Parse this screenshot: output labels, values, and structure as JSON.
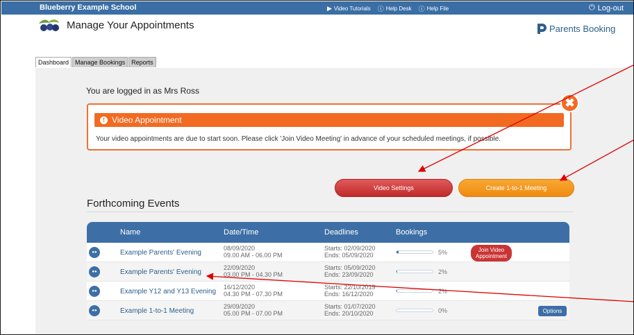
{
  "topbar": {
    "school": "Blueberry Example School",
    "links": [
      "Video Tutorials",
      "Help Desk",
      "Help File"
    ],
    "logout": "Log-out"
  },
  "header": {
    "title": "Manage Your Appointments",
    "brand": "Parents Booking"
  },
  "tabs": [
    "Dashboard",
    "Manage Bookings",
    "Reports"
  ],
  "active_tab": "Dashboard",
  "main": {
    "logged_in": "You are logged in as Mrs Ross",
    "alert": {
      "title": "Video Appointment",
      "body": "Your video appointments are due to start soon. Please click 'Join Video Meeting' in advance of your scheduled meetings, if possible."
    },
    "video_settings": "Video Settings",
    "create_meeting": "Create 1-to-1 Meeting",
    "section_title": "Forthcoming Events",
    "columns": [
      "Name",
      "Date/Time",
      "Deadlines",
      "Bookings"
    ],
    "events": [
      {
        "name": "Example Parents' Evening",
        "date": "08/09/2020",
        "time": "09.00 AM - 06.00 PM",
        "starts": "Starts: 02/09/2020",
        "ends": "Ends: 05/09/2020",
        "bookings_pct": "5%",
        "progress": 0.05,
        "action": "Join Video Appointment"
      },
      {
        "name": "Example Parents' Evening",
        "date": "22/09/2020",
        "time": "03.00 PM - 04.30 PM",
        "starts": "Starts: 05/09/2020",
        "ends": "Ends: 23/09/2020",
        "bookings_pct": "2%",
        "progress": 0.02,
        "action": ""
      },
      {
        "name": "Example Y12 and Y13 Evening",
        "date": "16/12/2020",
        "time": "04.30 PM - 07.30 PM",
        "starts": "Starts: 22/10/2019",
        "ends": "Ends: 16/12/2020",
        "bookings_pct": "2%",
        "progress": 0.02,
        "action": ""
      },
      {
        "name": "Example 1-to-1 Meeting",
        "date": "29/09/2020",
        "time": "05.00 PM - 07.00 PM",
        "starts": "Starts: 01/07/2020",
        "ends": "Ends: 20/10/2020",
        "bookings_pct": "0%",
        "progress": 0,
        "action": "Options"
      }
    ]
  },
  "colors": {
    "topbar": "#3a6ea5",
    "alert": "#f26a22",
    "video_button": "#c93434",
    "create_button": "#f5a020",
    "annotation": "#e00000"
  }
}
